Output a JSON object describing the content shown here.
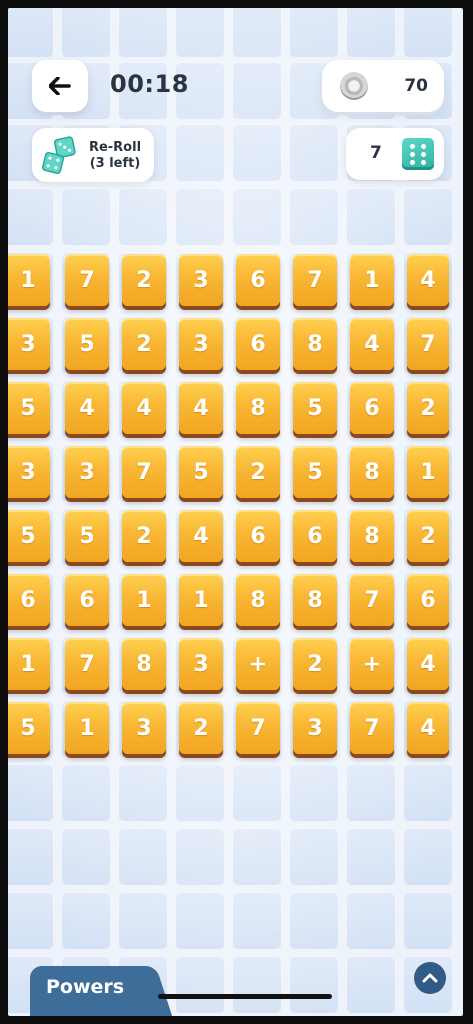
{
  "header": {
    "timer": "00:18",
    "coins": "70"
  },
  "reroll": {
    "title": "Re-Roll",
    "subtitle": "(3 left)"
  },
  "dice": {
    "count": "7"
  },
  "board": {
    "rows": [
      [
        "1",
        "7",
        "2",
        "3",
        "6",
        "7",
        "1",
        "4"
      ],
      [
        "3",
        "5",
        "2",
        "3",
        "6",
        "8",
        "4",
        "7"
      ],
      [
        "5",
        "4",
        "4",
        "4",
        "8",
        "5",
        "6",
        "2"
      ],
      [
        "3",
        "3",
        "7",
        "5",
        "2",
        "5",
        "8",
        "1"
      ],
      [
        "5",
        "5",
        "2",
        "4",
        "6",
        "6",
        "8",
        "2"
      ],
      [
        "6",
        "6",
        "1",
        "1",
        "8",
        "8",
        "7",
        "6"
      ],
      [
        "1",
        "7",
        "8",
        "3",
        "+",
        "2",
        "+",
        "4"
      ],
      [
        "5",
        "1",
        "3",
        "2",
        "7",
        "3",
        "7",
        "4"
      ]
    ]
  },
  "footer": {
    "powers_label": "Powers"
  },
  "colors": {
    "tile": "#f8b734",
    "tile_shadow": "#8a4a1e",
    "powers_tab": "#3f6d99",
    "background": "#eef3fb",
    "dice_icon": "#2db3a4"
  }
}
